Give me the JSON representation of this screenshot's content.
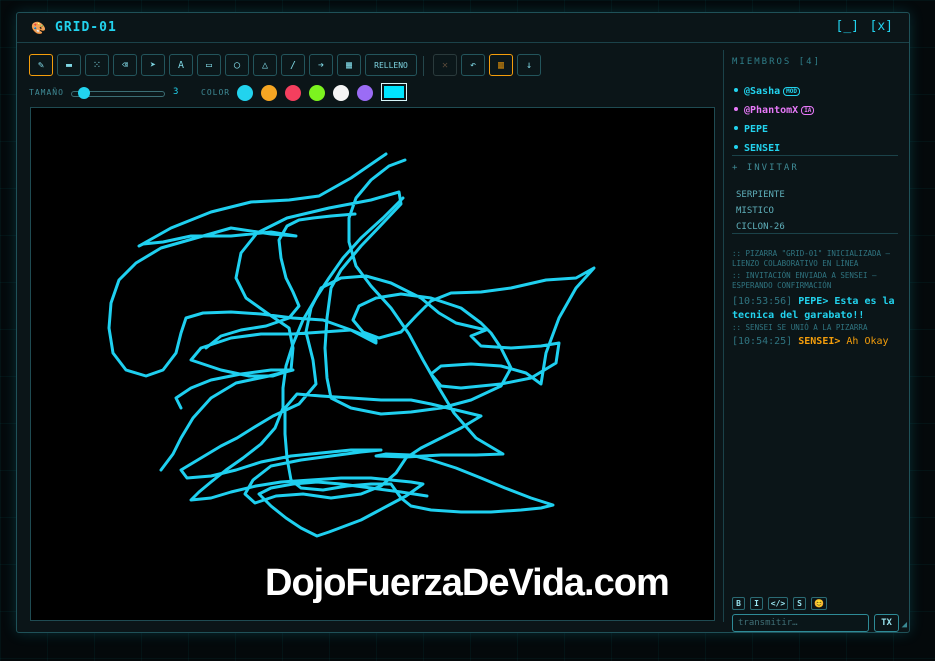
{
  "window": {
    "icon": "palette-icon",
    "title": "GRID-01",
    "minimize": "[_]",
    "close": "[x]"
  },
  "toolbar": {
    "tools": [
      {
        "name": "pencil-icon",
        "glyph": "✎"
      },
      {
        "name": "marker-icon",
        "glyph": "▬"
      },
      {
        "name": "spray-icon",
        "glyph": "⁙"
      },
      {
        "name": "eraser-icon",
        "glyph": "⌫"
      },
      {
        "name": "pointer-icon",
        "glyph": "➤"
      },
      {
        "name": "text-icon",
        "glyph": "A"
      },
      {
        "name": "rectangle-icon",
        "glyph": "▭"
      },
      {
        "name": "circle-icon",
        "glyph": "◯"
      },
      {
        "name": "triangle-icon",
        "glyph": "△"
      },
      {
        "name": "line-icon",
        "glyph": "/"
      },
      {
        "name": "arrow-icon",
        "glyph": "➔"
      },
      {
        "name": "grid-icon",
        "glyph": "▦"
      }
    ],
    "fill_label": "RELLENO",
    "actions": [
      {
        "name": "clear-icon",
        "glyph": "✕"
      },
      {
        "name": "undo-icon",
        "glyph": "↶"
      },
      {
        "name": "trash-icon",
        "glyph": "▥"
      },
      {
        "name": "download-icon",
        "glyph": "↓"
      }
    ]
  },
  "options": {
    "size_label": "TAMAÑO",
    "size_value": "3",
    "color_label": "COLOR",
    "colors": [
      "#22d3ee",
      "#f5a623",
      "#f43f5e",
      "#7cf31f",
      "#f5f5f5",
      "#9b6cf5"
    ],
    "current_color": "#00e5ff"
  },
  "canvas": {
    "watermark": "DojoFuerzaDeVida.com",
    "stroke_color": "#1fd0f0"
  },
  "sidebar": {
    "members_title": "MIEMBROS [4]",
    "members": [
      {
        "name": "@Sasha",
        "badge": "MOD",
        "color": "#22d3ee"
      },
      {
        "name": "@PhantomX",
        "badge": "IA",
        "color": "#e879f9"
      },
      {
        "name": "PEPE",
        "badge": "",
        "color": "#22d3ee"
      },
      {
        "name": "SENSEI",
        "badge": "",
        "color": "#22d3ee"
      }
    ],
    "invite_title": "+ INVITAR",
    "invites": [
      "SERPIENTE",
      "MISTICO",
      "CICLON-26"
    ],
    "log": [
      {
        "type": "system",
        "text": ":: PIZARRA \"GRID-01\" INICIALIZADA — LIENZO COLABORATIVO EN LÍNEA"
      },
      {
        "type": "system",
        "text": ":: INVITACIÓN ENVIADA A SENSEI — ESPERANDO CONFIRMACIÓN"
      },
      {
        "type": "msg",
        "time": "[10:53:56]",
        "user": "PEPE>",
        "text": " Esta es la tecnica del garabato!!",
        "color": "#22d3ee"
      },
      {
        "type": "system",
        "text": ":: SENSEI SE UNIÓ A LA PIZARRA"
      },
      {
        "type": "msg",
        "time": "[10:54:25]",
        "user": "SENSEI>",
        "text": " Ah Okay",
        "color": "#f59e0b"
      }
    ],
    "format_buttons": [
      "B",
      "I",
      "</>",
      "S",
      "😊"
    ],
    "input_placeholder": "transmitir…",
    "send_label": "TX"
  }
}
